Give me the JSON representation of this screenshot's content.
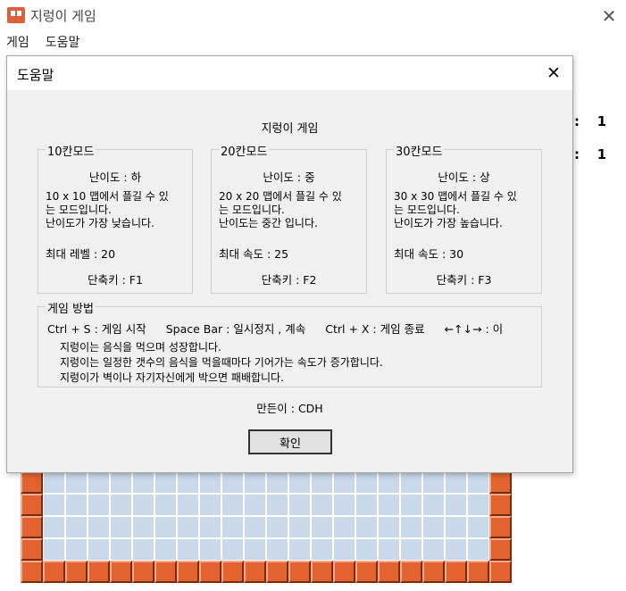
{
  "window": {
    "title": "지렁이 게임",
    "close_glyph": "✕"
  },
  "menu": {
    "items": [
      "게임",
      "도움말"
    ]
  },
  "scores": [
    {
      "sep": ":",
      "value": "1"
    },
    {
      "sep": ":",
      "value": "1"
    }
  ],
  "dialog": {
    "title": "도움말",
    "close_glyph": "✕",
    "game_title": "지렁이 게임",
    "modes": [
      {
        "legend": "10칸모드",
        "difficulty": "난이도 : 하",
        "desc1": "10 x 10 맵에서 플길 수 있",
        "desc2": "는 모드입니다.",
        "desc3": "난이도가 가장 낮습니다.",
        "stat": "최대 레벨 : 20",
        "shortcut": "단축키 : F1"
      },
      {
        "legend": "20칸모드",
        "difficulty": "난이도 : 중",
        "desc1": "20 x 20 맵에서 플길 수 있",
        "desc2": "는 모드입니다.",
        "desc3": "난이도는 중간 입니다.",
        "stat": "최대 속도 : 25",
        "shortcut": "단축키 : F2"
      },
      {
        "legend": "30칸모드",
        "difficulty": "난이도 : 상",
        "desc1": "30 x 30 맵에서 플길 수 있",
        "desc2": "는 모드입니다.",
        "desc3": "난이도가 가장 높습니다.",
        "stat": "최대 속도 : 30",
        "shortcut": "단축키 : F3"
      }
    ],
    "howto": {
      "legend": "게임 방법",
      "controls": [
        "Ctrl + S : 게임 시작",
        "Space Bar : 일시정지 , 계속",
        "Ctrl + X : 게임 종료",
        "←↑↓→ : 이"
      ],
      "rules": [
        "지렁이는 음식을 먹으며 성장합니다.",
        "지렁이는 일정한 갯수의 음식을 먹을때마다 기어가는 속도가 증가합니다.",
        "지렁이가 벽이나 자기자신에게 박으면 패배합니다."
      ]
    },
    "author": "만든이 : CDH",
    "ok_label": "확인"
  },
  "colors": {
    "brick": "#e2632f",
    "board_cell": "#c9d9ea",
    "dialog_bg": "#f0f0f0"
  }
}
